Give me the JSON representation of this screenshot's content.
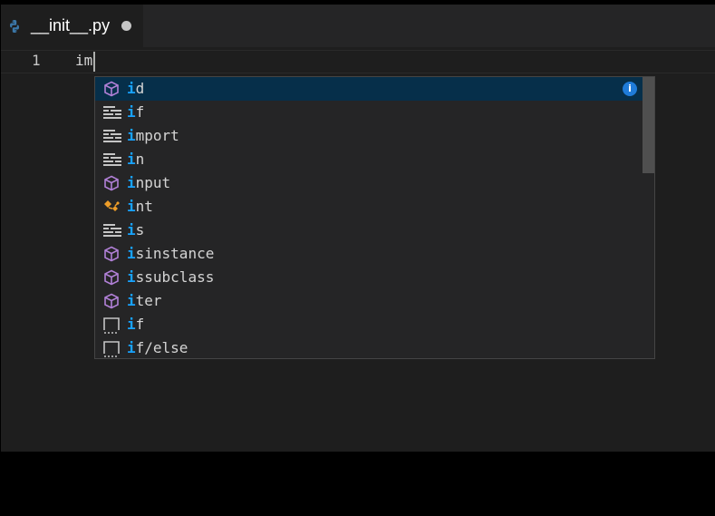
{
  "tab": {
    "title": "__init__.py",
    "icon": "python-file-icon",
    "dirty": true
  },
  "editor": {
    "line_number": "1",
    "typed_text": "im"
  },
  "suggestions": {
    "selected_index": 0,
    "items": [
      {
        "match": "i",
        "rest": "d",
        "kind": "method-cube-icon"
      },
      {
        "match": "i",
        "rest": "f",
        "kind": "keyword-icon"
      },
      {
        "match": "i",
        "rest": "mport",
        "kind": "keyword-icon"
      },
      {
        "match": "i",
        "rest": "n",
        "kind": "keyword-icon"
      },
      {
        "match": "i",
        "rest": "nput",
        "kind": "method-cube-icon"
      },
      {
        "match": "i",
        "rest": "nt",
        "kind": "class-icon"
      },
      {
        "match": "i",
        "rest": "s",
        "kind": "keyword-icon"
      },
      {
        "match": "i",
        "rest": "sinstance",
        "kind": "method-cube-icon"
      },
      {
        "match": "i",
        "rest": "ssubclass",
        "kind": "method-cube-icon"
      },
      {
        "match": "i",
        "rest": "ter",
        "kind": "method-cube-icon"
      },
      {
        "match": "i",
        "rest": "f",
        "kind": "snippet-icon"
      },
      {
        "match": "i",
        "rest": "f/else",
        "kind": "snippet-icon"
      }
    ],
    "info_icon": "info-icon",
    "colors": {
      "match_highlight": "#18a3ff",
      "selected_row": "#062f4a",
      "method_icon": "#b180d7",
      "class_icon": "#ee9d28"
    }
  }
}
